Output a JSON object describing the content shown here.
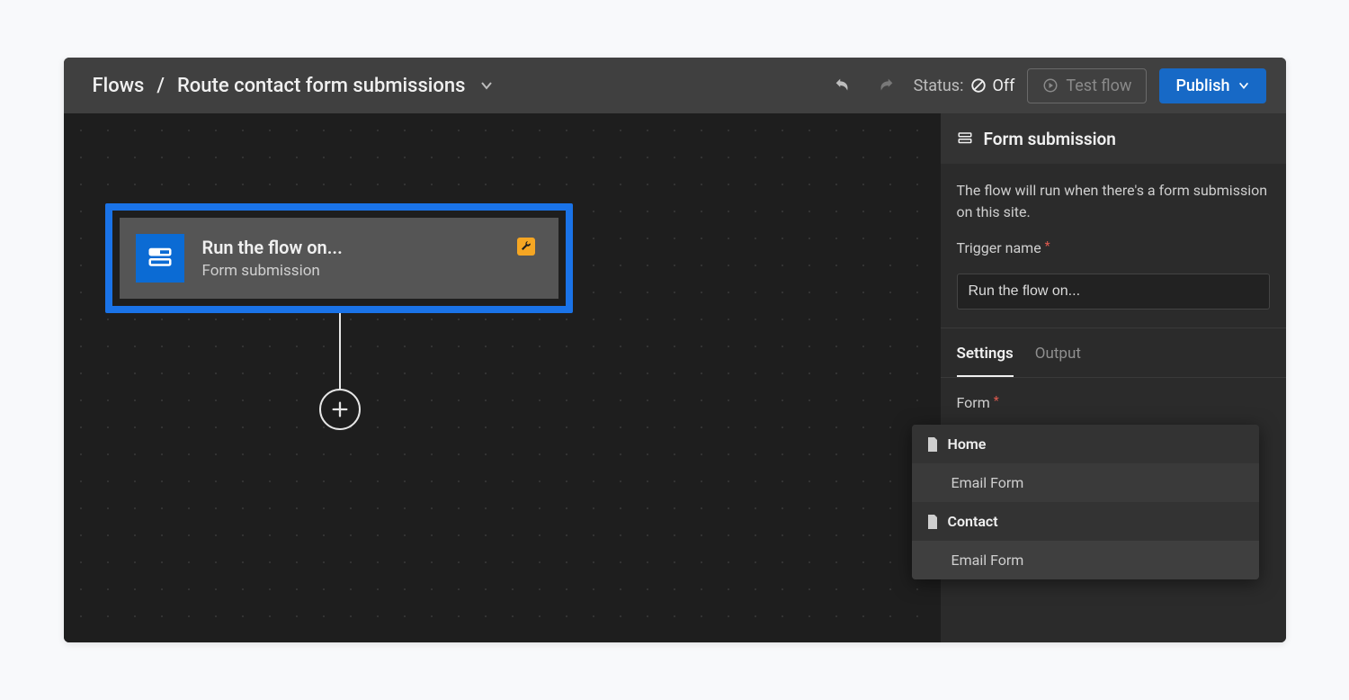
{
  "toolbar": {
    "breadcrumb_root": "Flows",
    "breadcrumb_sep": "/",
    "breadcrumb_current": "Route contact form submissions",
    "status_label": "Status:",
    "status_value": "Off",
    "test_flow_label": "Test flow",
    "publish_label": "Publish"
  },
  "canvas": {
    "node_title": "Run the flow on...",
    "node_subtitle": "Form submission"
  },
  "sidebar": {
    "panel_title": "Form submission",
    "description": "The flow will run when there's a form submission on this site.",
    "trigger_name_label": "Trigger name",
    "trigger_name_value": "Run the flow on...",
    "tabs": {
      "settings": "Settings",
      "output": "Output"
    },
    "form_label": "Form"
  },
  "dropdown": {
    "groups": [
      {
        "label": "Home",
        "items": [
          "Email Form"
        ]
      },
      {
        "label": "Contact",
        "items": [
          "Email Form"
        ]
      }
    ]
  }
}
